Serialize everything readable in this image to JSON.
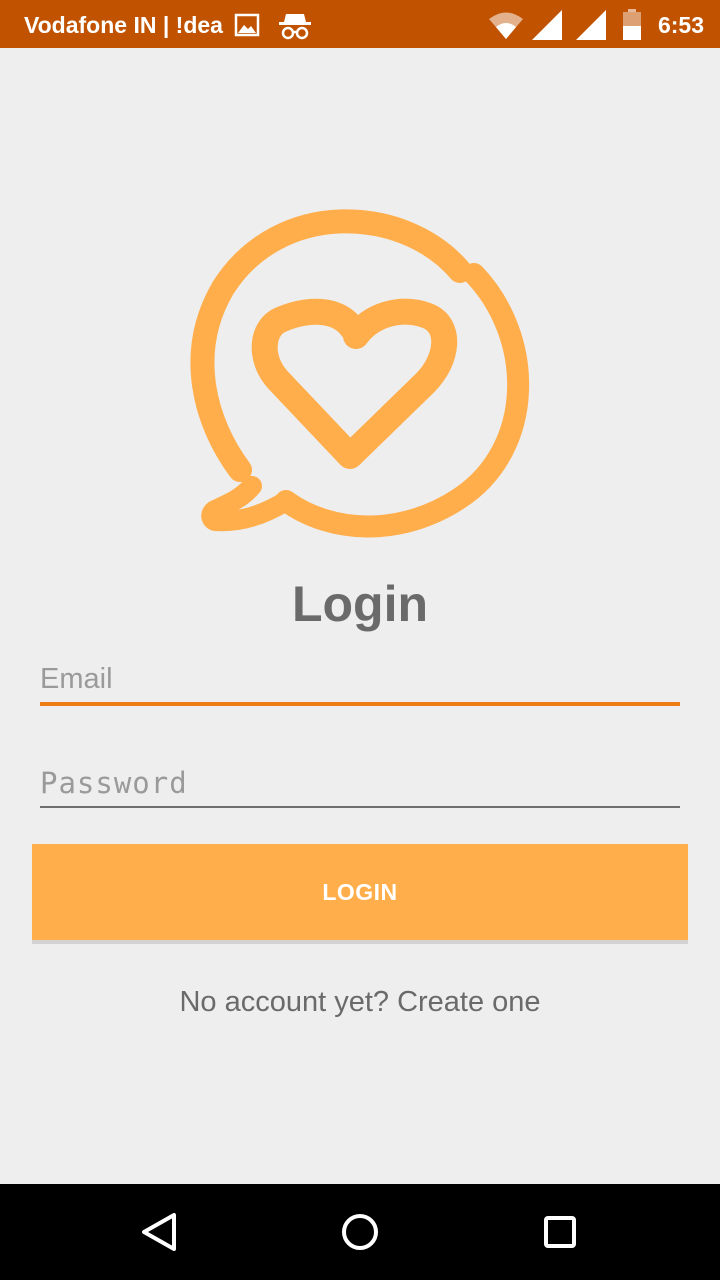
{
  "status_bar": {
    "carrier": "Vodafone IN | !dea",
    "time": "6:53",
    "icons": [
      "image-icon",
      "incognito-icon",
      "wifi-icon",
      "signal-icon",
      "signal-icon",
      "battery-icon"
    ],
    "background_color": "#c05200"
  },
  "logo": {
    "icon": "chat-heart-logo-icon",
    "color": "#ffae4b"
  },
  "login": {
    "title": "Login",
    "email_placeholder": "Email",
    "password_placeholder": "Password",
    "button_label": "LOGIN",
    "signup_text": "No account yet? Create one"
  },
  "nav_bar": {
    "icons": [
      "back-icon",
      "home-icon",
      "recents-icon"
    ]
  },
  "colors": {
    "accent": "#ef7d16",
    "button": "#ffae4b",
    "background": "#eeeeee"
  }
}
